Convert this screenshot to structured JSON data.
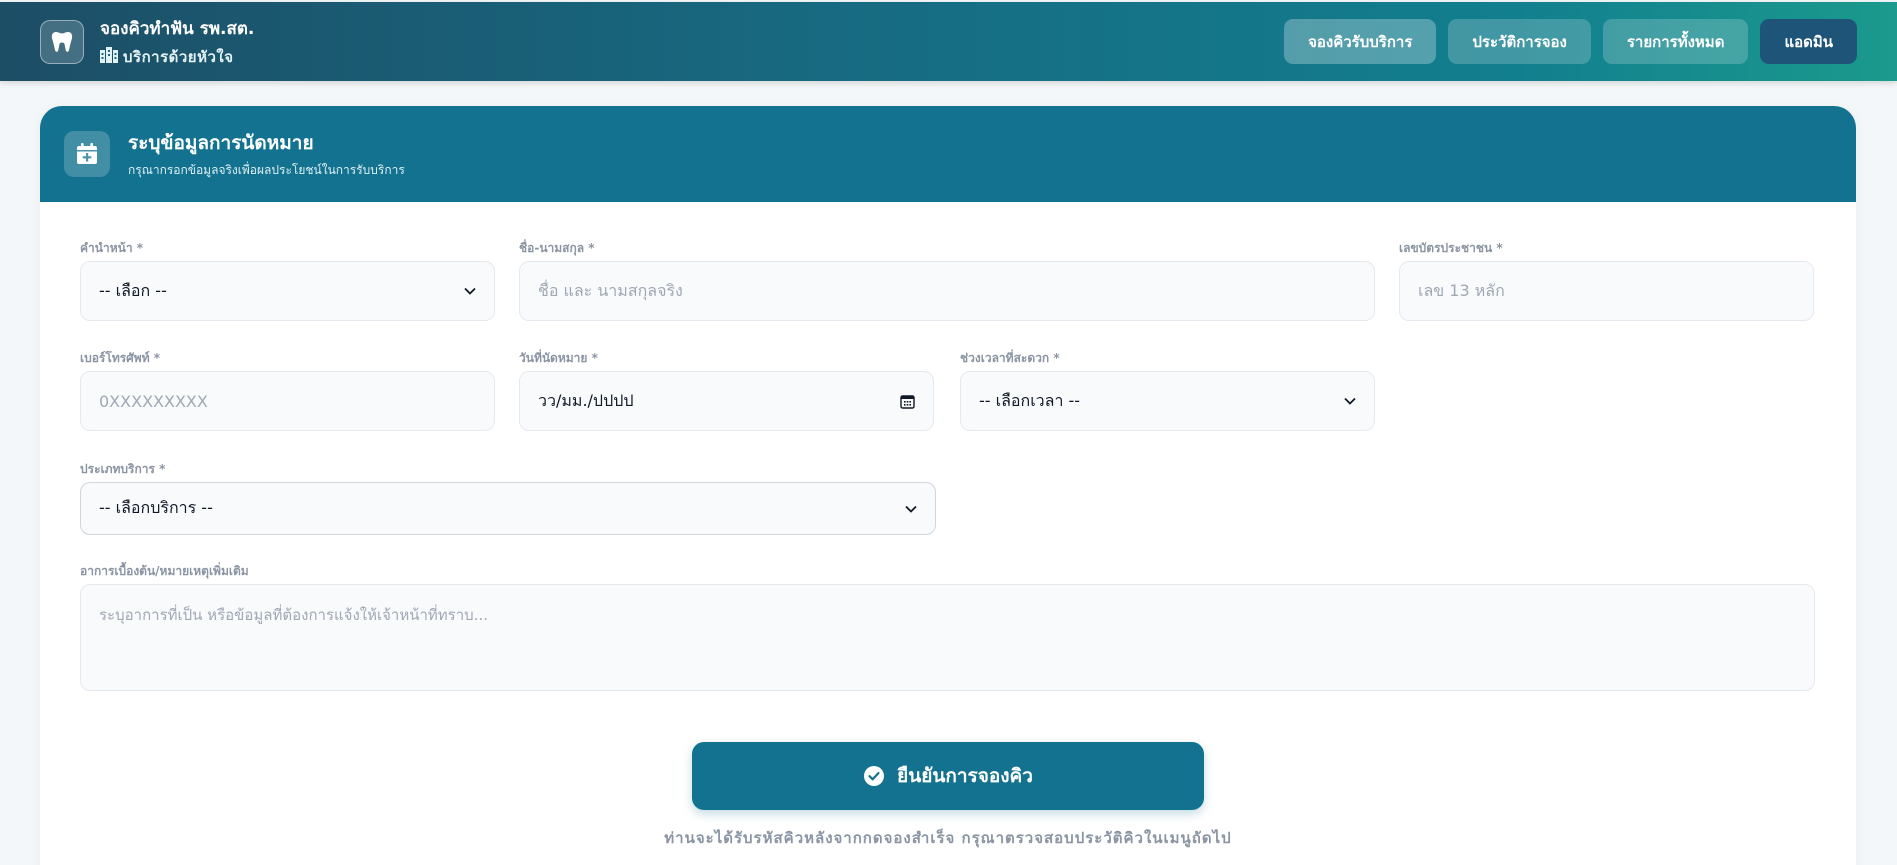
{
  "header": {
    "title": "จองคิวทำฟัน รพ.สต.",
    "subtitle": "บริการด้วยหัวใจ",
    "logo_icon": "tooth-icon",
    "subtitle_icon": "hospital-icon"
  },
  "nav": {
    "book": "จองคิวรับบริการ",
    "history": "ประวัติการจอง",
    "all": "รายการทั้งหมด",
    "admin": "แอดมิน"
  },
  "form": {
    "title": "ระบุข้อมูลการนัดหมาย",
    "subtitle": "กรุณากรอกข้อมูลจริงเพื่อผลประโยชน์ในการรับบริการ",
    "title_icon": "calendar-plus-icon",
    "prefix": {
      "label": "คำนำหน้า *",
      "value": "-- เลือก --"
    },
    "name": {
      "label": "ชื่อ-นามสกุล *",
      "placeholder": "ชื่อ และ นามสกุลจริง"
    },
    "id_card": {
      "label": "เลขบัตรประชาชน *",
      "placeholder": "เลข 13 หลัก"
    },
    "phone": {
      "label": "เบอร์โทรศัพท์ *",
      "placeholder": "0XXXXXXXXX"
    },
    "date": {
      "label": "วันที่นัดหมาย *",
      "value": "วว/มม./ปปปป"
    },
    "time": {
      "label": "ช่วงเวลาที่สะดวก *",
      "value": "-- เลือกเวลา --"
    },
    "service": {
      "label": "ประเภทบริการ *",
      "value": "-- เลือกบริการ --"
    },
    "notes": {
      "label": "อาการเบื้องต้น/หมายเหตุเพิ่มเติม",
      "placeholder": "ระบุอาการที่เป็น หรือข้อมูลที่ต้องการแจ้งให้เจ้าหน้าที่ทราบ..."
    },
    "submit": "ยืนยันการจองคิว",
    "note": "ท่านจะได้รับรหัสคิวหลังจากกดจองสำเร็จ กรุณาตรวจสอบประวัติคิวในเมนูถัดไป"
  },
  "colors": {
    "primary": "#12728f",
    "admin": "#1d5477",
    "label": "#8a94a3"
  }
}
